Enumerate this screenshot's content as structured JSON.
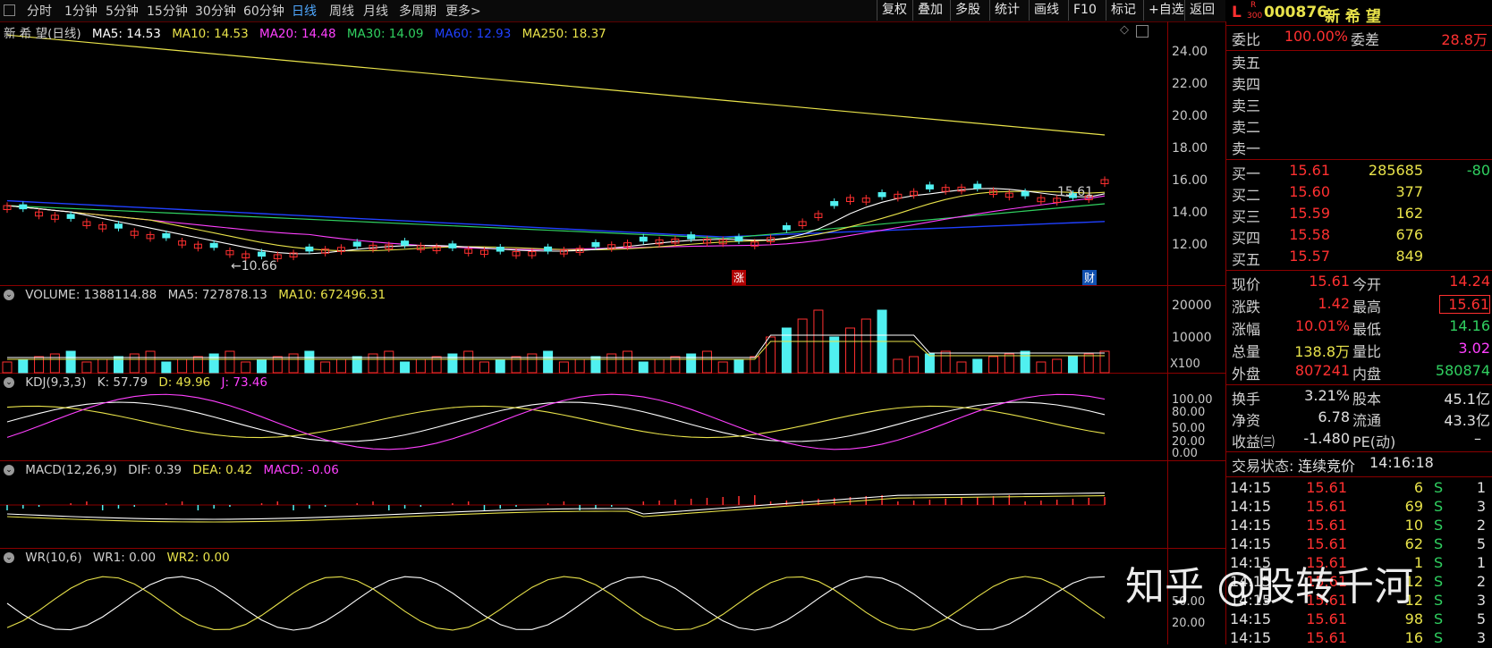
{
  "toolbar": {
    "periods": [
      "分时",
      "1分钟",
      "5分钟",
      "15分钟",
      "30分钟",
      "60分钟",
      "日线",
      "周线",
      "月线",
      "多周期",
      "更多>"
    ],
    "active_period": "日线",
    "buttons": [
      "复权",
      "叠加",
      "多股",
      "统计",
      "画线",
      "F10",
      "标记",
      "+自选",
      "返回"
    ]
  },
  "main_chart": {
    "name": "新 希 望(日线)",
    "ma": [
      {
        "label": "MA5: 14.53",
        "color": "#ffffff"
      },
      {
        "label": "MA10: 14.53",
        "color": "#e8e24a"
      },
      {
        "label": "MA20: 14.48",
        "color": "#ff40ff"
      },
      {
        "label": "MA30: 14.09",
        "color": "#30d060"
      },
      {
        "label": "MA60: 12.93",
        "color": "#2040ff"
      },
      {
        "label": "MA250: 18.37",
        "color": "#e8e24a"
      }
    ],
    "yticks": [
      "24.00",
      "22.00",
      "20.00",
      "18.00",
      "16.00",
      "14.00",
      "12.00"
    ],
    "low_label": "←10.66",
    "high_label": "15.61",
    "markers": [
      "涨",
      "财"
    ]
  },
  "volume_panel": {
    "title_items": [
      {
        "label": "VOLUME: 1388114.88",
        "color": "#d0d0d0"
      },
      {
        "label": "MA5: 727878.13",
        "color": "#d0d0d0"
      },
      {
        "label": "MA10: 672496.31",
        "color": "#e8e24a"
      }
    ],
    "yticks": [
      "20000",
      "10000"
    ],
    "unit": "X100"
  },
  "kdj_panel": {
    "title_items": [
      {
        "label": "KDJ(9,3,3)",
        "color": "#d0d0d0"
      },
      {
        "label": "K: 57.79",
        "color": "#d0d0d0"
      },
      {
        "label": "D: 49.96",
        "color": "#e8e24a"
      },
      {
        "label": "J: 73.46",
        "color": "#ff40ff"
      }
    ],
    "yticks": [
      "100.00",
      "80.00",
      "50.00",
      "20.00",
      "0.00"
    ]
  },
  "macd_panel": {
    "title_items": [
      {
        "label": "MACD(12,26,9)",
        "color": "#d0d0d0"
      },
      {
        "label": "DIF: 0.39",
        "color": "#d0d0d0"
      },
      {
        "label": "DEA: 0.42",
        "color": "#e8e24a"
      },
      {
        "label": "MACD: -0.06",
        "color": "#ff40ff"
      }
    ]
  },
  "wr_panel": {
    "title_items": [
      {
        "label": "WR(10,6)",
        "color": "#d0d0d0"
      },
      {
        "label": "WR1: 0.00",
        "color": "#d0d0d0"
      },
      {
        "label": "WR2: 0.00",
        "color": "#e8e24a"
      }
    ],
    "yticks": [
      "50.00",
      "20.00"
    ]
  },
  "quote": {
    "header_prefix": "L",
    "header_tag_top": "R",
    "header_tag_bottom": "300",
    "code": "000876",
    "name": "新 希 望",
    "weibi_label": "委比",
    "weibi_value": "100.00%",
    "weicha_label": "委差",
    "weicha_value": "28.8万",
    "sell_labels": [
      "卖五",
      "卖四",
      "卖三",
      "卖二",
      "卖一"
    ],
    "buys": [
      {
        "label": "买一",
        "price": "15.61",
        "vol": "285685",
        "chg": "-80"
      },
      {
        "label": "买二",
        "price": "15.60",
        "vol": "377",
        "chg": ""
      },
      {
        "label": "买三",
        "price": "15.59",
        "vol": "162",
        "chg": ""
      },
      {
        "label": "买四",
        "price": "15.58",
        "vol": "676",
        "chg": ""
      },
      {
        "label": "买五",
        "price": "15.57",
        "vol": "849",
        "chg": ""
      }
    ],
    "stats": [
      {
        "l1": "现价",
        "v1": "15.61",
        "c1": "red",
        "l2": "今开",
        "v2": "14.24",
        "c2": "red"
      },
      {
        "l1": "涨跌",
        "v1": "1.42",
        "c1": "red",
        "l2": "最高",
        "v2": "15.61",
        "c2": "red"
      },
      {
        "l1": "涨幅",
        "v1": "10.01%",
        "c1": "red",
        "l2": "最低",
        "v2": "14.16",
        "c2": "grn"
      },
      {
        "l1": "总量",
        "v1": "138.8万",
        "c1": "yel",
        "l2": "量比",
        "v2": "3.02",
        "c2": "mag"
      },
      {
        "l1": "外盘",
        "v1": "807241",
        "c1": "red",
        "l2": "内盘",
        "v2": "580874",
        "c2": "grn"
      }
    ],
    "stats2": [
      {
        "l1": "换手",
        "v1": "3.21%",
        "l2": "股本",
        "v2": "45.1亿"
      },
      {
        "l1": "净资",
        "v1": "6.78",
        "l2": "流通",
        "v2": "43.3亿"
      },
      {
        "l1": "收益㈢",
        "v1": "-1.480",
        "l2": "PE(动)",
        "v2": "–"
      }
    ],
    "trade_status_label": "交易状态:",
    "trade_status": "连续竞价",
    "trade_time": "14:16:18",
    "ticks": [
      {
        "time": "14:15",
        "price": "15.61",
        "vol": "6",
        "bs": "S",
        "n": "1"
      },
      {
        "time": "14:15",
        "price": "15.61",
        "vol": "69",
        "bs": "S",
        "n": "3"
      },
      {
        "time": "14:15",
        "price": "15.61",
        "vol": "10",
        "bs": "S",
        "n": "2"
      },
      {
        "time": "14:15",
        "price": "15.61",
        "vol": "62",
        "bs": "S",
        "n": "5"
      },
      {
        "time": "14:15",
        "price": "15.61",
        "vol": "1",
        "bs": "S",
        "n": "1"
      },
      {
        "time": "14:15",
        "price": "15.61",
        "vol": "12",
        "bs": "S",
        "n": "2"
      },
      {
        "time": "14:15",
        "price": "15.61",
        "vol": "12",
        "bs": "S",
        "n": "3"
      },
      {
        "time": "14:15",
        "price": "15.61",
        "vol": "98",
        "bs": "S",
        "n": "5"
      },
      {
        "time": "14:15",
        "price": "15.61",
        "vol": "16",
        "bs": "S",
        "n": "3"
      }
    ]
  },
  "watermark": "知乎 @股转千河",
  "colors": {
    "up": "#ff3030",
    "down": "#50f0f0",
    "grid": "#8b0000",
    "ma250": "#e8e24a",
    "ma60": "#2040ff",
    "ma30": "#30d060",
    "ma20": "#ff40ff",
    "ma10": "#e8e24a",
    "ma5": "#ffffff"
  }
}
